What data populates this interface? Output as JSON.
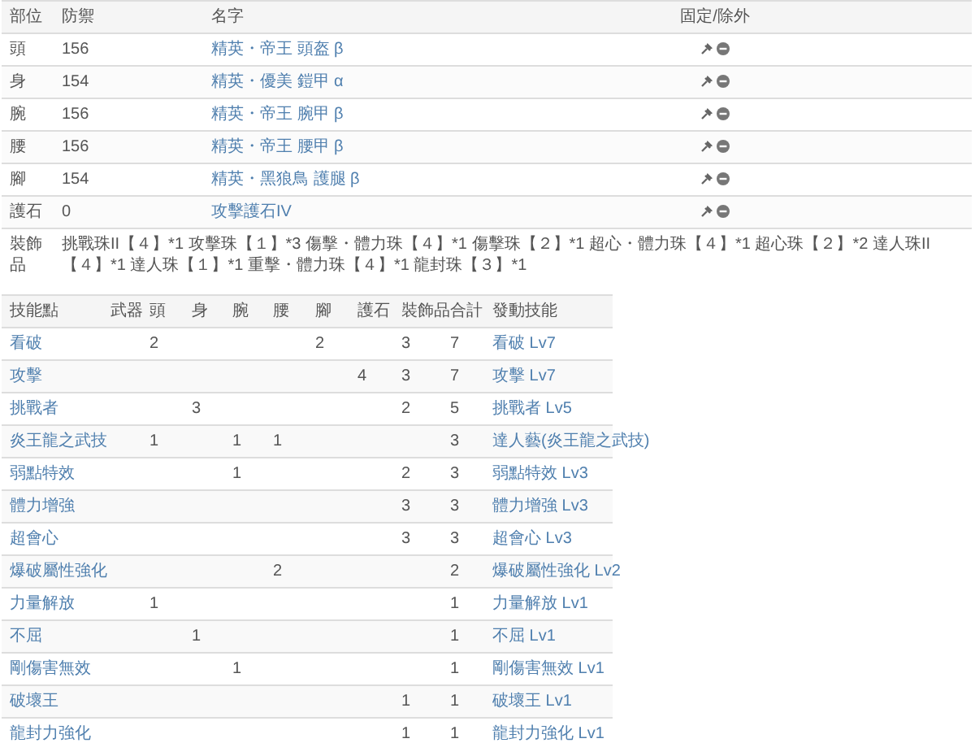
{
  "equipment": {
    "columns": [
      "部位",
      "防禦",
      "名字",
      "固定/除外"
    ],
    "rows": [
      {
        "part": "頭",
        "defense": "156",
        "name": "精英・帝王 頭盔 β"
      },
      {
        "part": "身",
        "defense": "154",
        "name": "精英・優美 鎧甲 α"
      },
      {
        "part": "腕",
        "defense": "156",
        "name": "精英・帝王 腕甲 β"
      },
      {
        "part": "腰",
        "defense": "156",
        "name": "精英・帝王 腰甲 β"
      },
      {
        "part": "腳",
        "defense": "154",
        "name": "精英・黑狼鳥 護腿 β"
      },
      {
        "part": "護石",
        "defense": "0",
        "name": "攻擊護石IV"
      }
    ],
    "decorations": {
      "label": "裝飾品",
      "text": "挑戰珠II【４】*1 攻擊珠【１】*3 傷擊・體力珠【４】*1 傷擊珠【２】*1 超心・體力珠【４】*1 超心珠【２】*2 達人珠II【４】*1 達人珠【１】*1 重擊・體力珠【４】*1 龍封珠【３】*1"
    }
  },
  "skills": {
    "columns": [
      "技能點",
      "武器",
      "頭",
      "身",
      "腕",
      "腰",
      "腳",
      "護石",
      "裝飾品",
      "合計",
      "發動技能"
    ],
    "rows": [
      {
        "skill": "看破",
        "head": "2",
        "legs": "2",
        "deco": "3",
        "total": "7",
        "active": "看破 Lv7"
      },
      {
        "skill": "攻擊",
        "charm": "4",
        "deco": "3",
        "total": "7",
        "active": "攻擊 Lv7"
      },
      {
        "skill": "挑戰者",
        "body": "3",
        "deco": "2",
        "total": "5",
        "active": "挑戰者 Lv5"
      },
      {
        "skill": "炎王龍之武技",
        "head": "1",
        "arms": "1",
        "waist": "1",
        "total": "3",
        "active": "達人藝(炎王龍之武技)"
      },
      {
        "skill": "弱點特效",
        "arms": "1",
        "deco": "2",
        "total": "3",
        "active": "弱點特效 Lv3"
      },
      {
        "skill": "體力增強",
        "deco": "3",
        "total": "3",
        "active": "體力增強 Lv3"
      },
      {
        "skill": "超會心",
        "deco": "3",
        "total": "3",
        "active": "超會心 Lv3"
      },
      {
        "skill": "爆破屬性強化",
        "waist": "2",
        "total": "2",
        "active": "爆破屬性強化 Lv2"
      },
      {
        "skill": "力量解放",
        "head": "1",
        "total": "1",
        "active": "力量解放 Lv1"
      },
      {
        "skill": "不屈",
        "body": "1",
        "total": "1",
        "active": "不屈 Lv1"
      },
      {
        "skill": "剛傷害無效",
        "arms": "1",
        "total": "1",
        "active": "剛傷害無效 Lv1"
      },
      {
        "skill": "破壞王",
        "deco": "1",
        "total": "1",
        "active": "破壞王 Lv1"
      },
      {
        "skill": "龍封力強化",
        "deco": "1",
        "total": "1",
        "active": "龍封力強化 Lv1"
      }
    ]
  }
}
